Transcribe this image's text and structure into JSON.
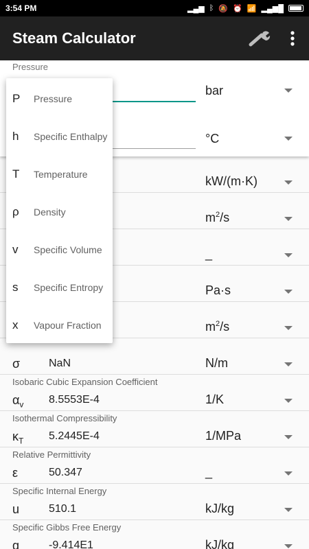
{
  "status_bar": {
    "time": "3:54 PM"
  },
  "app_bar": {
    "title": "Steam Calculator",
    "wrench_icon": "wrench-icon",
    "more_icon": "more-vert-icon"
  },
  "inputs": {
    "first": {
      "label": "Pressure",
      "unit": "bar"
    },
    "second": {
      "unit": "°C"
    }
  },
  "rows": [
    {
      "label": "",
      "symbol": "",
      "value": "",
      "unit": "kW/(m·K)"
    },
    {
      "label": "",
      "symbol": "",
      "value": "",
      "unit_base": "m",
      "unit_sup": "2",
      "unit_tail": "/s"
    },
    {
      "label": "",
      "symbol": "",
      "value": "",
      "unit": "_"
    },
    {
      "label": "",
      "symbol": "",
      "value": "",
      "unit": "Pa·s"
    },
    {
      "label": "",
      "symbol": "",
      "value": "",
      "unit_base": "m",
      "unit_sup": "2",
      "unit_tail": "/s"
    },
    {
      "label": "",
      "symbol": "σ",
      "value": "NaN",
      "unit": "N/m"
    },
    {
      "label": "Isobaric Cubic Expansion Coefficient",
      "symbol": "α",
      "symbol_sub": "v",
      "value": "8.5553E-4",
      "unit": "1/K"
    },
    {
      "label": "Isothermal Compressibility",
      "symbol": "κ",
      "symbol_sub": "T",
      "value": "5.2445E-4",
      "unit": "1/MPa"
    },
    {
      "label": "Relative Permittivity",
      "symbol": "ε",
      "value": "50.347",
      "unit": "_"
    },
    {
      "label": "Specific Internal Energy",
      "symbol": "u",
      "value": "510.1",
      "unit": "kJ/kg"
    },
    {
      "label": "Specific Gibbs Free Energy",
      "symbol": "g",
      "value": "-9.414E1",
      "unit": "kJ/kg"
    }
  ],
  "menu": {
    "items": [
      {
        "symbol": "P",
        "name": "Pressure"
      },
      {
        "symbol": "h",
        "name": "Specific Enthalpy"
      },
      {
        "symbol": "T",
        "name": "Temperature"
      },
      {
        "symbol": "ρ",
        "name": "Density"
      },
      {
        "symbol": "v",
        "name": "Specific Volume"
      },
      {
        "symbol": "s",
        "name": "Specific Entropy"
      },
      {
        "symbol": "x",
        "name": "Vapour Fraction"
      }
    ]
  },
  "colors": {
    "app_bar": "#212121",
    "accent": "#009688"
  }
}
